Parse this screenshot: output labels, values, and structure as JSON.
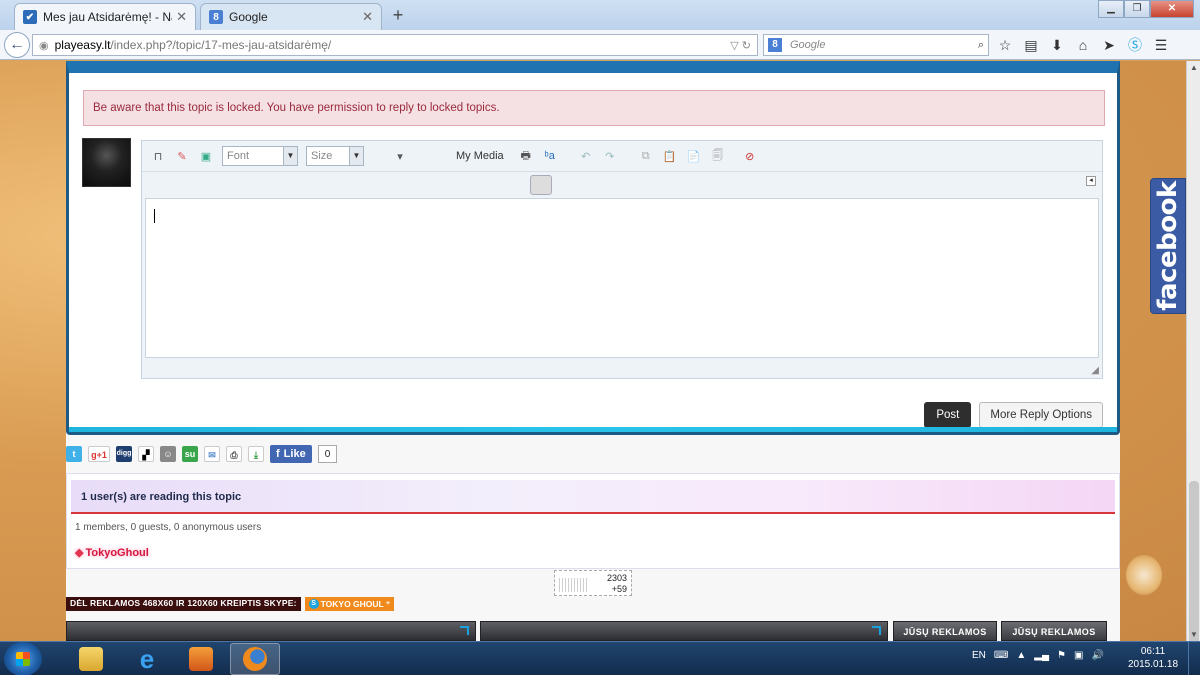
{
  "browser": {
    "tabs": [
      {
        "title": "Mes jau Atsidarėmę! - Nauj...",
        "active": true
      },
      {
        "title": "Google",
        "active": false
      }
    ],
    "url_host": "playeasy.lt",
    "url_path": "/index.php?/topic/17-mes-jau-atsidarėmę/",
    "search_placeholder": "Google"
  },
  "notice": "Be aware that this topic is locked. You have permission to reply to locked topics.",
  "editor": {
    "font_label": "Font",
    "size_label": "Size",
    "my_media": "My Media"
  },
  "buttons": {
    "post": "Post",
    "more_options": "More Reply Options"
  },
  "share": {
    "like_label": "Like",
    "like_count": "0",
    "gplus": "g+1",
    "digg": "digg"
  },
  "readers": {
    "title": "1 user(s) are reading this topic",
    "stats": "1 members, 0 guests, 0 anonymous users",
    "user": "TokyoGhoul"
  },
  "counter": {
    "total": "2303",
    "delta": "+59"
  },
  "ads": {
    "text": "DĖL REKLAMOS 468X60 IR 120X60 KREIPTIS SKYPE:",
    "skype": "TOKYO GHOUL",
    "your_ads_1": "JŪSŲ REKLAMOS",
    "your_ads_2": "JŪSŲ REKLAMOS"
  },
  "facebook_tab": "facebook",
  "taskbar": {
    "lang": "EN",
    "time": "06:11",
    "date": "2015.01.18"
  },
  "colors": {
    "accent_blue": "#1e73b0",
    "notice_text": "#9a2a3c",
    "facebook": "#3b5ba4",
    "username": "#d4173e"
  }
}
